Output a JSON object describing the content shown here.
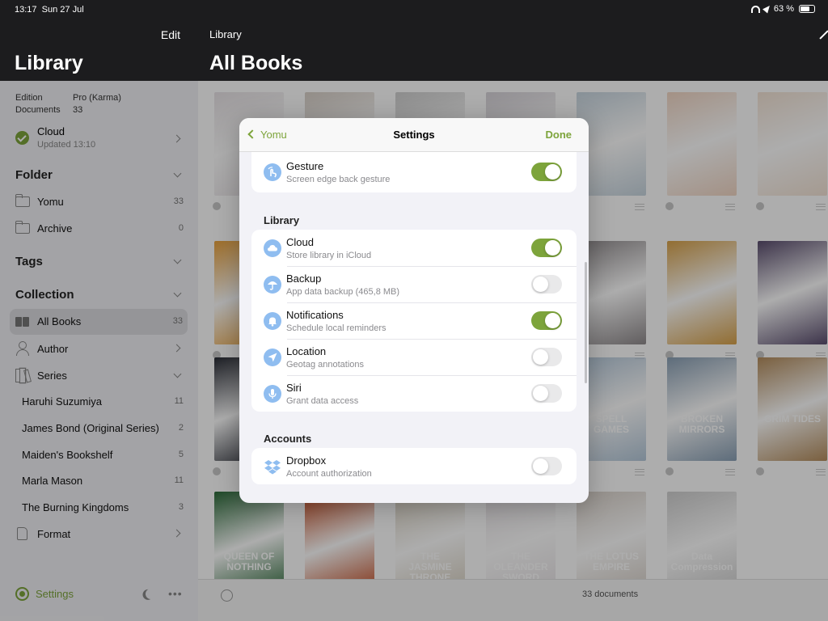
{
  "status_bar": {
    "time": "13:17",
    "date": "Sun 27 Jul",
    "battery": "63 %"
  },
  "sidebar": {
    "edit_label": "Edit",
    "title": "Library",
    "edition_label": "Edition",
    "edition_value": "Pro (Karma)",
    "documents_label": "Documents",
    "documents_value": "33",
    "cloud": {
      "name": "Cloud",
      "status": "Updated 13:10"
    },
    "folder_section": "Folder",
    "folders": [
      {
        "label": "Yomu",
        "count": "33"
      },
      {
        "label": "Archive",
        "count": "0"
      }
    ],
    "tags_section": "Tags",
    "collection_section": "Collection",
    "collection": {
      "all_books": {
        "label": "All Books",
        "count": "33"
      },
      "author": "Author",
      "series": "Series",
      "series_items": [
        {
          "label": "Haruhi Suzumiya",
          "count": "11"
        },
        {
          "label": "James Bond (Original Series)",
          "count": "2"
        },
        {
          "label": "Maiden's Bookshelf",
          "count": "5"
        },
        {
          "label": "Marla Mason",
          "count": "11"
        },
        {
          "label": "The Burning Kingdoms",
          "count": "3"
        }
      ],
      "format": "Format"
    },
    "settings_label": "Settings"
  },
  "main": {
    "breadcrumb": "Library",
    "title": "All Books",
    "doc_count": "33 documents",
    "cover_colors": [
      "#e8e3e6",
      "#d8d0c8",
      "#cfcfcf",
      "#d6d2d8",
      "#c7d5df",
      "#f1d6c4",
      "#f3e3d5",
      "#e9a23d",
      "#5d5f66",
      "#3b2f24",
      "#1f2033",
      "#8f8a8c",
      "#d8a24a",
      "#5a4d6e",
      "#2a2d36",
      "#1b2e4a",
      "#18325c",
      "#4a3a2d",
      "#b4c8da",
      "#8aa0b5",
      "#b48d5d",
      "#2d6b3a",
      "#c2471d",
      "#d8d0c0"
    ],
    "cover_texts": {
      "spell_games": "SPELL GAMES",
      "broken_mirrors": "BROKEN MIRRORS",
      "grim_tides": "GRIM TIDES",
      "queen": "QUEEN OF NOTHING",
      "jasmine": "THE JASMINE THRONE",
      "oleander": "THE OLEANDER SWORD",
      "lotus": "THE LOTUS EMPIRE",
      "data": "Data Compression"
    }
  },
  "modal": {
    "back_label": "Yomu",
    "title": "Settings",
    "done_label": "Done",
    "gesture": {
      "title": "Gesture",
      "subtitle": "Screen edge back gesture",
      "on": true
    },
    "library_header": "Library",
    "library_rows": [
      {
        "title": "Cloud",
        "subtitle": "Store library in iCloud",
        "on": true,
        "icon": "cloud-icon"
      },
      {
        "title": "Backup",
        "subtitle": "App data backup (465,8 MB)",
        "on": false,
        "icon": "umbrella-icon"
      },
      {
        "title": "Notifications",
        "subtitle": "Schedule local reminders",
        "on": true,
        "icon": "bell-icon"
      },
      {
        "title": "Location",
        "subtitle": "Geotag annotations",
        "on": false,
        "icon": "location-arrow-icon"
      },
      {
        "title": "Siri",
        "subtitle": "Grant data access",
        "on": false,
        "icon": "microphone-icon"
      }
    ],
    "accounts_header": "Accounts",
    "dropbox": {
      "title": "Dropbox",
      "subtitle": "Account authorization",
      "on": false
    },
    "accent_color": "#7da43b",
    "icon_color": "#8fbdf0"
  }
}
